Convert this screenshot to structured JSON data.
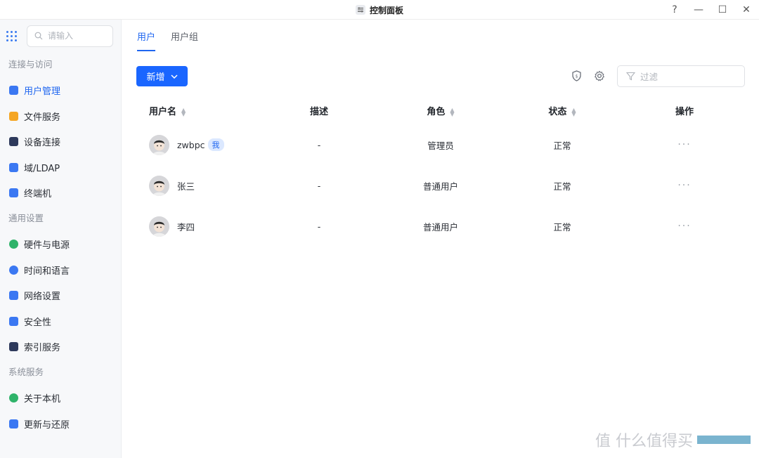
{
  "window": {
    "title": "控制面板",
    "help": "?",
    "minimize": "—",
    "maximize": "☐",
    "close": "✕"
  },
  "search": {
    "placeholder": "请输入"
  },
  "sidebar": {
    "sections": [
      {
        "label": "连接与访问",
        "items": [
          {
            "label": "用户管理",
            "icon": "user-manage-icon",
            "color": "#3b78f2",
            "active": true
          },
          {
            "label": "文件服务",
            "icon": "folder-icon",
            "color": "#f5a623"
          },
          {
            "label": "设备连接",
            "icon": "device-icon",
            "color": "#2e3a5c"
          },
          {
            "label": "域/LDAP",
            "icon": "domain-icon",
            "color": "#3b78f2"
          },
          {
            "label": "终端机",
            "icon": "terminal-icon",
            "color": "#3b78f2"
          }
        ]
      },
      {
        "label": "通用设置",
        "items": [
          {
            "label": "硬件与电源",
            "icon": "hardware-icon",
            "color": "#2fb36a"
          },
          {
            "label": "时间和语言",
            "icon": "globe-icon",
            "color": "#3b78f2"
          },
          {
            "label": "网络设置",
            "icon": "network-icon",
            "color": "#3b78f2"
          },
          {
            "label": "安全性",
            "icon": "shield-icon",
            "color": "#3b78f2"
          },
          {
            "label": "索引服务",
            "icon": "index-icon",
            "color": "#2e3a5c"
          }
        ]
      },
      {
        "label": "系统服务",
        "items": [
          {
            "label": "关于本机",
            "icon": "info-icon",
            "color": "#2fb36a"
          },
          {
            "label": "更新与还原",
            "icon": "refresh-icon",
            "color": "#3b78f2"
          }
        ]
      }
    ]
  },
  "tabs": [
    {
      "label": "用户",
      "active": true
    },
    {
      "label": "用户组",
      "active": false
    }
  ],
  "toolbar": {
    "add_label": "新增",
    "filter_placeholder": "过滤"
  },
  "table": {
    "headers": {
      "username": "用户名",
      "desc": "描述",
      "role": "角色",
      "status": "状态",
      "actions": "操作"
    },
    "rows": [
      {
        "username": "zwbpc",
        "badge": "我",
        "desc": "-",
        "role": "管理员",
        "status": "正常",
        "actions": "···"
      },
      {
        "username": "张三",
        "badge": "",
        "desc": "-",
        "role": "普通用户",
        "status": "正常",
        "actions": "···"
      },
      {
        "username": "李四",
        "badge": "",
        "desc": "-",
        "role": "普通用户",
        "status": "正常",
        "actions": "···"
      }
    ]
  },
  "watermark": {
    "text": "值 什么值得买"
  },
  "colors": {
    "accent": "#1a66ff",
    "sidebar_bg": "#f7f8fa"
  }
}
